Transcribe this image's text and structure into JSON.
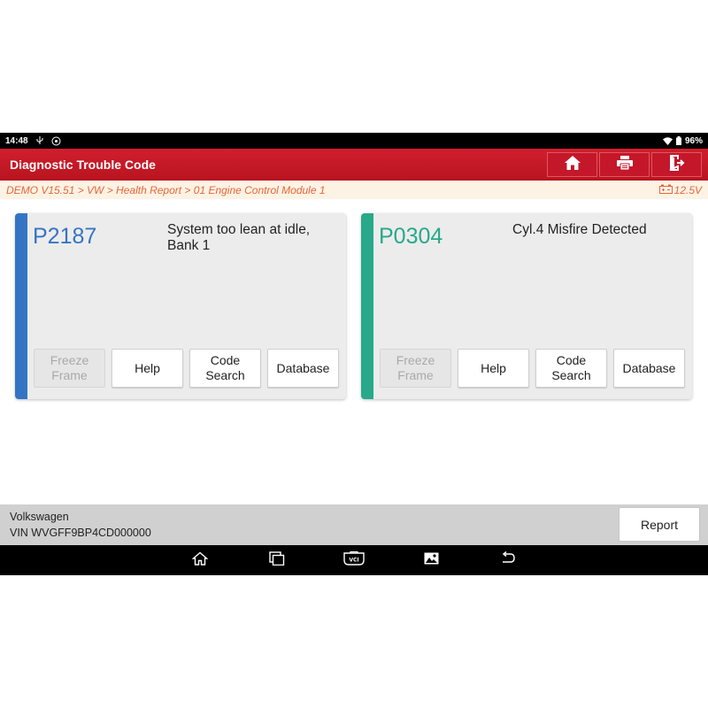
{
  "status_bar": {
    "time": "14:48",
    "battery": "96%",
    "icons": [
      "usb-icon",
      "debug-icon",
      "wifi-icon",
      "battery-icon"
    ]
  },
  "titlebar": {
    "title": "Diagnostic Trouble Code",
    "buttons": [
      "home-icon",
      "print-icon",
      "exit-icon"
    ]
  },
  "breadcrumb": {
    "path": "DEMO V15.51 > VW > Health Report > 01 Engine Control Module 1",
    "voltage": "12.5V"
  },
  "colors": {
    "title_red": "#c4172a",
    "card1_accent": "#3574c4",
    "card2_accent": "#27a98a",
    "breadcrumb_text": "#e8653a"
  },
  "cards": [
    {
      "code": "P2187",
      "description": "System too lean at idle, Bank 1",
      "buttons": {
        "freeze_frame": "Freeze\nFrame",
        "help": "Help",
        "code_search": "Code\nSearch",
        "database": "Database"
      }
    },
    {
      "code": "P0304",
      "description": "Cyl.4 Misfire Detected",
      "buttons": {
        "freeze_frame": "Freeze\nFrame",
        "help": "Help",
        "code_search": "Code\nSearch",
        "database": "Database"
      }
    }
  ],
  "footer": {
    "vehicle": "Volkswagen",
    "vin": "VIN WVGFF9BP4CD000000",
    "report_button": "Report"
  },
  "navbar": {
    "buttons": [
      "home-nav-icon",
      "recents-icon",
      "vci-icon",
      "gallery-icon",
      "back-icon"
    ],
    "vci_label": "VCI"
  }
}
